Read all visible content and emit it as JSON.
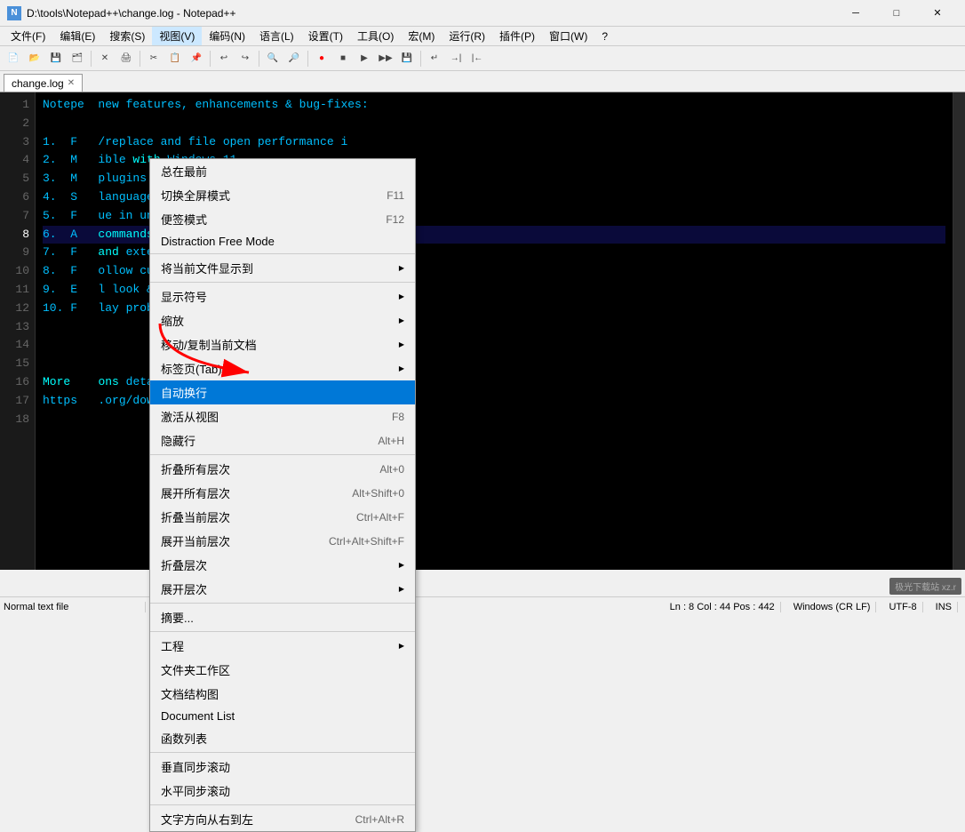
{
  "titleBar": {
    "icon": "N++",
    "text": "D:\\tools\\Notepad++\\change.log - Notepad++",
    "minBtn": "─",
    "maxBtn": "□",
    "closeBtn": "✕"
  },
  "menuBar": {
    "items": [
      "文件(F)",
      "编辑(E)",
      "搜索(S)",
      "视图(V)",
      "编码(N)",
      "语言(L)",
      "设置(T)",
      "工具(O)",
      "宏(M)",
      "运行(R)",
      "插件(P)",
      "窗口(W)",
      "?"
    ]
  },
  "tabs": [
    {
      "label": "change.log",
      "active": true
    }
  ],
  "viewMenu": {
    "items": [
      {
        "label": "总在最前",
        "shortcut": ""
      },
      {
        "label": "切换全屏模式",
        "shortcut": "F11"
      },
      {
        "label": "便签模式",
        "shortcut": "F12"
      },
      {
        "label": "Distraction Free Mode",
        "shortcut": ""
      },
      {
        "label": "---"
      },
      {
        "label": "将当前文件显示到",
        "shortcut": "",
        "hasSubmenu": true
      },
      {
        "label": "---"
      },
      {
        "label": "显示符号",
        "shortcut": "",
        "hasSubmenu": true
      },
      {
        "label": "缩放",
        "shortcut": "",
        "hasSubmenu": true
      },
      {
        "label": "移动/复制当前文档",
        "shortcut": "",
        "hasSubmenu": true
      },
      {
        "label": "标签页(Tab)",
        "shortcut": "",
        "hasSubmenu": true
      },
      {
        "label": "自动换行",
        "shortcut": "",
        "highlighted": true
      },
      {
        "label": "激活从视图",
        "shortcut": "F8"
      },
      {
        "label": "隐藏行",
        "shortcut": "Alt+H"
      },
      {
        "label": "---"
      },
      {
        "label": "折叠所有层次",
        "shortcut": "Alt+0"
      },
      {
        "label": "展开所有层次",
        "shortcut": "Alt+Shift+0"
      },
      {
        "label": "折叠当前层次",
        "shortcut": "Ctrl+Alt+F"
      },
      {
        "label": "展开当前层次",
        "shortcut": "Ctrl+Alt+Shift+F"
      },
      {
        "label": "折叠层次",
        "shortcut": "",
        "hasSubmenu": true
      },
      {
        "label": "展开层次",
        "shortcut": "",
        "hasSubmenu": true
      },
      {
        "label": "---"
      },
      {
        "label": "摘要...",
        "shortcut": ""
      },
      {
        "label": "---"
      },
      {
        "label": "工程",
        "shortcut": "",
        "hasSubmenu": true
      },
      {
        "label": "文件夹工作区",
        "shortcut": ""
      },
      {
        "label": "文档结构图",
        "shortcut": ""
      },
      {
        "label": "Document List",
        "shortcut": ""
      },
      {
        "label": "函数列表",
        "shortcut": ""
      },
      {
        "label": "---"
      },
      {
        "label": "垂直同步滚动",
        "shortcut": ""
      },
      {
        "label": "水平同步滚动",
        "shortcut": ""
      },
      {
        "label": "---"
      },
      {
        "label": "文字方向从右到左",
        "shortcut": "Ctrl+Alt+R"
      }
    ]
  },
  "editorLines": [
    {
      "num": "1",
      "text": "Notepad  new features, enhancements & bug-fixes:"
    },
    {
      "num": "2",
      "text": ""
    },
    {
      "num": "3",
      "text": "1.  F    /replace and file open performance i"
    },
    {
      "num": "4",
      "text": "2.  M    ible with Windows 11."
    },
    {
      "num": "5",
      "text": "3.  M    plugins' toolbar icons display in bo"
    },
    {
      "num": "6",
      "text": "4.  S    language (syntax highlighting, auto-com"
    },
    {
      "num": "7",
      "text": "5.  F    ue in uninstaller."
    },
    {
      "num": "8",
      "text": "6.  A    commands for both short & long format"
    },
    {
      "num": "9",
      "text": "7.  F    extension issue with RTL languages."
    },
    {
      "num": "10",
      "text": "8.  F    ollow current doc\" not working issue w"
    },
    {
      "num": "11",
      "text": "9.  E    l look & feel."
    },
    {
      "num": "12",
      "text": "10.  F    lay problem in installer."
    },
    {
      "num": "13",
      "text": ""
    },
    {
      "num": "14",
      "text": ""
    },
    {
      "num": "15",
      "text": ""
    },
    {
      "num": "16",
      "text": "More    ons detail:"
    },
    {
      "num": "17",
      "text": "https    .org/downloads/v8.1.4/"
    },
    {
      "num": "18",
      "text": ""
    }
  ],
  "statusBar": {
    "fileType": "Normal text file",
    "position": "Ln : 8    Col : 44    Pos : 442",
    "lineEnding": "Windows (CR LF)",
    "encoding": "UTF-8",
    "insertMode": "INS"
  },
  "watermark": "极光下载站  xz.r"
}
